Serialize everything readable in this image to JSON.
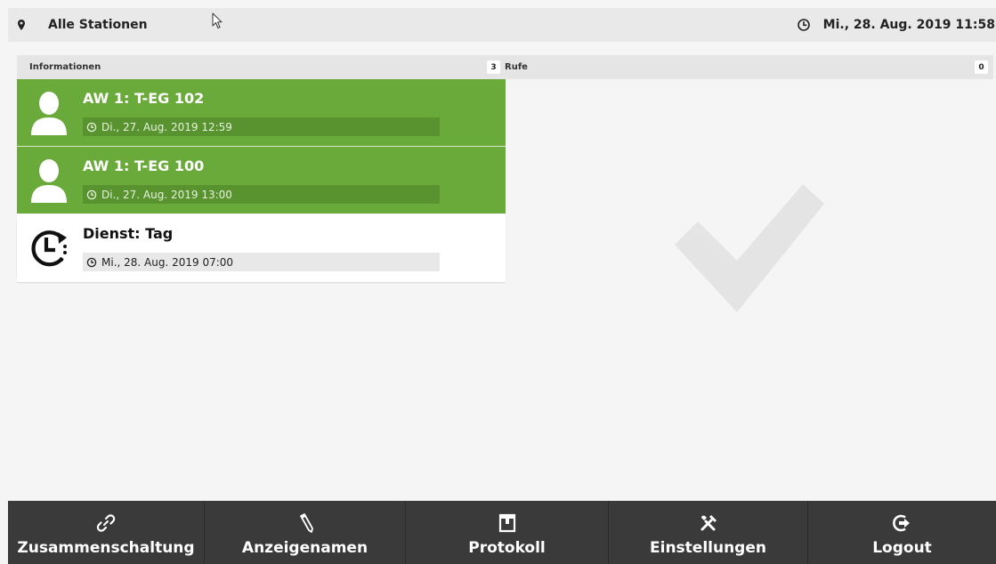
{
  "topbar": {
    "station": "Alle Stationen",
    "datetime": "Mi., 28. Aug. 2019 11:58",
    "pin_icon": "map-pin-icon",
    "clock_icon": "clock-icon"
  },
  "panels": {
    "informationen": {
      "title": "Informationen",
      "count": "3"
    },
    "rufe": {
      "title": "Rufe",
      "count": "0"
    }
  },
  "cards": [
    {
      "icon": "person-icon",
      "title": "AW 1: T-EG 102",
      "time": "Di., 27. Aug. 2019 12:59",
      "color": "#6aaa3a"
    },
    {
      "icon": "person-icon",
      "title": "AW 1: T-EG 100",
      "time": "Di., 27. Aug. 2019 13:00",
      "color": "#6aaa3a"
    },
    {
      "icon": "shift-clock-icon",
      "title": "Dienst: Tag",
      "time": "Mi., 28. Aug. 2019 07:00",
      "color": "#ffffff"
    }
  ],
  "rufe_empty_icon": "checkmark-icon",
  "nav": [
    {
      "label": "Zusammenschaltung",
      "icon": "link-icon"
    },
    {
      "label": "Anzeigenamen",
      "icon": "pencil-icon"
    },
    {
      "label": "Protokoll",
      "icon": "logbook-icon"
    },
    {
      "label": "Einstellungen",
      "icon": "tools-icon"
    },
    {
      "label": "Logout",
      "icon": "logout-icon"
    }
  ],
  "colors": {
    "accent_green": "#6aaa3a",
    "timebar_green": "#589330",
    "nav_bg": "#3a3a3a",
    "page_bg": "#f5f5f5"
  }
}
